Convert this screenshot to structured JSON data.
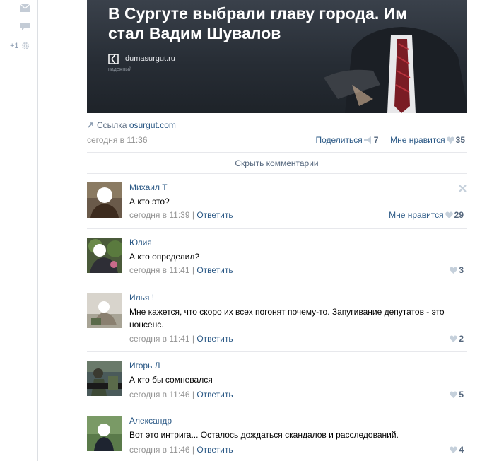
{
  "left_rail": {
    "like_count": "+1"
  },
  "post": {
    "title": "В Сургуте выбрали главу города. Им стал Вадим Шувалов",
    "image_source": "dumasurgut.ru",
    "image_source_sub": "надежный",
    "link_label": "Ссылка",
    "link_domain": "osurgut.com",
    "date": "сегодня в 11:36",
    "share_label": "Поделиться",
    "share_count": "7",
    "like_label": "Мне нравится",
    "like_count": "35",
    "hide_comments_label": "Скрыть комментарии"
  },
  "comments": [
    {
      "author": "Михаил Т",
      "text": "А кто это?",
      "date": "сегодня в 11:39",
      "reply": "Ответить",
      "like_label": "Мне нравится",
      "likes": "29"
    },
    {
      "author": "Юлия",
      "text": "А кто определил?",
      "date": "сегодня в 11:41",
      "reply": "Ответить",
      "likes": "3"
    },
    {
      "author": "Илья !",
      "text": "Мне кажется, что скоро их всех погонят почему-то. Запугивание депутатов - это нонсенс.",
      "date": "сегодня в 11:41",
      "reply": "Ответить",
      "likes": "2"
    },
    {
      "author": "Игорь Л",
      "text": "А кто бы сомневался",
      "date": "сегодня в 11:46",
      "reply": "Ответить",
      "likes": "5"
    },
    {
      "author": "Александр",
      "text": "Вот это интрига... Осталось дождаться скандалов и расследований.",
      "date": "сегодня в 11:46",
      "reply": "Ответить",
      "likes": "4"
    }
  ],
  "separator": "|",
  "icons": {
    "rail": [
      "mail-icon",
      "comment-icon",
      "gear-icon"
    ],
    "post": [
      "link-icon",
      "share-icon",
      "heart-icon"
    ],
    "comment": [
      "close-icon",
      "heart-icon"
    ]
  },
  "colors": {
    "link": "#2a5885",
    "muted": "#939393",
    "heart": "#c5d0db",
    "divider": "#e7e8ec"
  }
}
